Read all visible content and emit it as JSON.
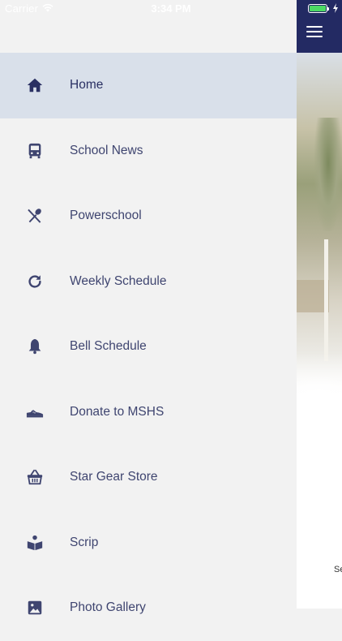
{
  "status_bar": {
    "carrier": "Carrier",
    "time": "3:34 PM",
    "battery_level": 1.0
  },
  "drawer": {
    "active_index": 0,
    "items": [
      {
        "label": "Home",
        "icon": "home-icon"
      },
      {
        "label": "School News",
        "icon": "bus-icon"
      },
      {
        "label": "Powerschool",
        "icon": "utensils-icon"
      },
      {
        "label": "Weekly Schedule",
        "icon": "refresh-icon"
      },
      {
        "label": "Bell Schedule",
        "icon": "bell-icon"
      },
      {
        "label": "Donate to MSHS",
        "icon": "shoe-icon"
      },
      {
        "label": "Star Gear Store",
        "icon": "basket-icon"
      },
      {
        "label": "Scrip",
        "icon": "book-reader-icon"
      },
      {
        "label": "Photo Gallery",
        "icon": "image-icon"
      }
    ]
  },
  "app": {
    "partial_text": "Se"
  },
  "colors": {
    "header": "#232a63",
    "drawer_bg": "#f2f2f2",
    "active_row": "#d9e0ea",
    "icon": "#3f4570",
    "label": "#3f4570"
  }
}
